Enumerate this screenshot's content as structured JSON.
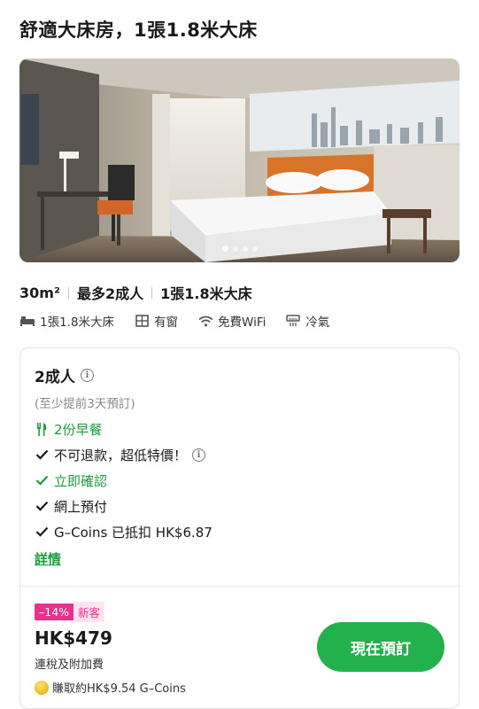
{
  "room": {
    "title": "舒適大床房，1張1.8米大床",
    "photo_alt": "hotel room photo"
  },
  "specs": {
    "area": "30m²",
    "occupancy": "最多2成人",
    "bed": "1張1.8米大床"
  },
  "amenities": [
    {
      "icon": "bed-icon",
      "label": "1張1.8米大床"
    },
    {
      "icon": "window-icon",
      "label": "有窗"
    },
    {
      "icon": "wifi-icon",
      "label": "免費WiFi"
    },
    {
      "icon": "air-conditioner-icon",
      "label": "冷氣"
    }
  ],
  "carousel": {
    "total": 4,
    "active": 0
  },
  "rate": {
    "persons": "2成人",
    "advance_note": "(至少提前3天預訂)",
    "features": {
      "breakfast": "2份早餐",
      "refund": "不可退款，超低特價！",
      "confirm": "立即確認",
      "payment": "網上預付",
      "gcoins": "G–Coins 已抵扣 HK$6.87"
    },
    "details_link": "詳情",
    "badge_discount": "–14%",
    "badge_new": "新客",
    "price": "HK$479",
    "tax_note": "連稅及附加費",
    "coins_earn": "賺取約HK$9.54 G–Coins",
    "book_button": "現在預訂"
  },
  "colors": {
    "accent_green": "#22b14c",
    "text_green": "#1f9b3f",
    "badge_pink": "#e8308c",
    "badge_pink_light": "#fde3ef"
  }
}
